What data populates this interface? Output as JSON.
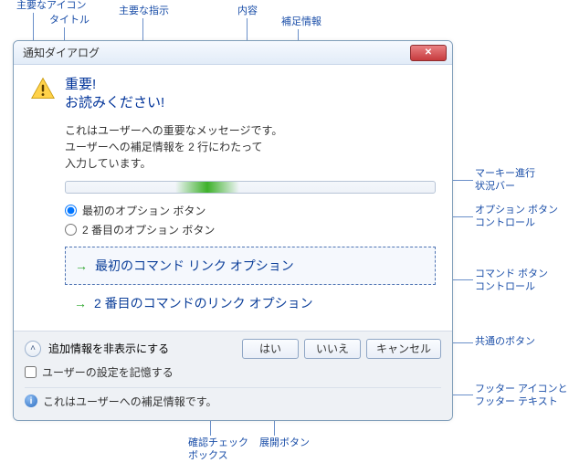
{
  "labels": {
    "main_icon": "主要なアイコン",
    "title": "タイトル",
    "main_instruction": "主要な指示",
    "content": "内容",
    "supp_info": "補足情報",
    "marquee": "マーキー進行\n状況バー",
    "radio_ctrl": "オプション ボタン\nコントロール",
    "cmd_ctrl": "コマンド ボタン\nコントロール",
    "common_btn": "共通のボタン",
    "footer_icon_text": "フッター アイコンと\nフッター テキスト",
    "expand_btn": "展開ボタン",
    "verify_chk": "確認チェック\nボックス"
  },
  "dialog": {
    "title": "通知ダイアログ",
    "close_glyph": "✕",
    "instruction_line1": "重要!",
    "instruction_line2": "お読みください!",
    "body_line1": "これはユーザーへの重要なメッセージです。",
    "body_line2": "ユーザーへの補足情報を 2 行にわたって",
    "body_line3": "入力しています。",
    "radio1": "最初のオプション ボタン",
    "radio2": "2 番目のオプション ボタン",
    "cmd1": "最初のコマンド リンク オプション",
    "cmd2": "2 番目のコマンドのリンク オプション",
    "expand_text": "追加情報を非表示にする",
    "verify_text": "ユーザーの設定を記憶する",
    "footer_text": "これはユーザーへの補足情報です。",
    "btn_yes": "はい",
    "btn_no": "いいえ",
    "btn_cancel": "キャンセル",
    "arrow": "→",
    "chev_up": "˄",
    "info_glyph": "i"
  }
}
